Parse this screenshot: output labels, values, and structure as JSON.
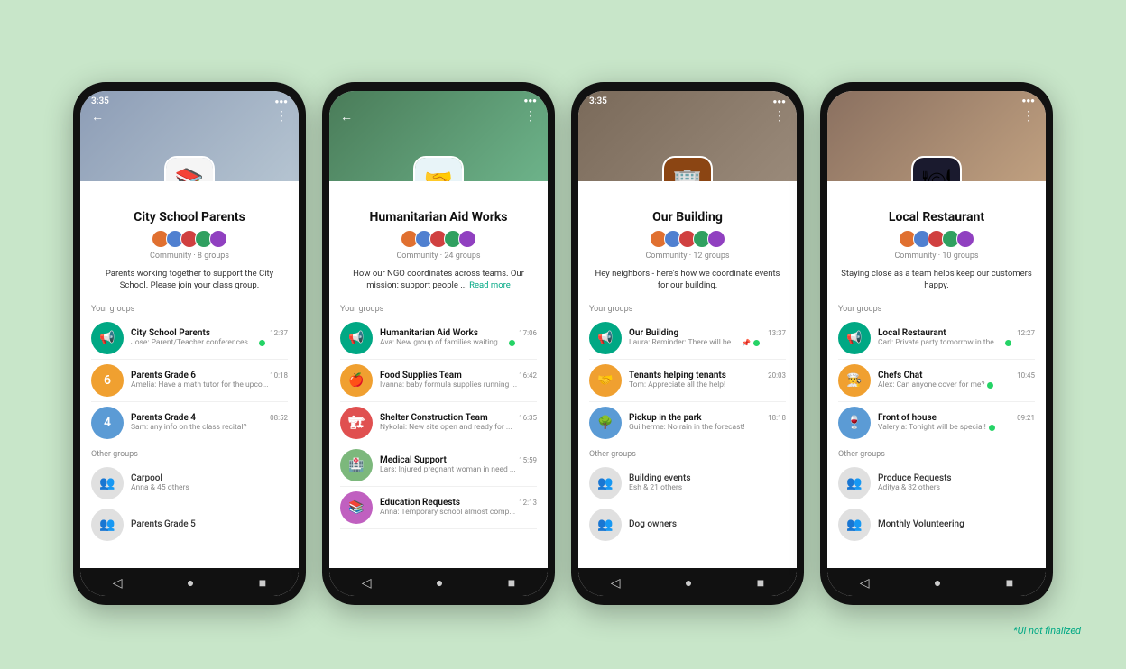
{
  "disclaimer": "*UI not finalized",
  "phones": [
    {
      "id": "city-school",
      "statusTime": "3:35",
      "headerClass": "hdr-school",
      "iconEmoji": "📚",
      "iconClass": "school-icon",
      "communityName": "City School Parents",
      "memberColors": [
        "#e07030",
        "#5080d0",
        "#d04040",
        "#30a060",
        "#9040c0"
      ],
      "meta": "Community · 8 groups",
      "description": "Parents working together to support the City School. Please join your class group.",
      "hasReadMore": false,
      "yourGroupsLabel": "Your groups",
      "yourGroups": [
        {
          "name": "City School Parents",
          "time": "12:37",
          "preview": "Jose: Parent/Teacher conferences ...",
          "hasDot": true,
          "avatarClass": "green-icon",
          "avatarIcon": "📢"
        },
        {
          "name": "Parents Grade 6",
          "time": "10:18",
          "preview": "Amelia: Have a math tutor for the upco...",
          "hasDot": false,
          "avatarClass": "color1",
          "avatarIcon": "6"
        },
        {
          "name": "Parents Grade 4",
          "time": "08:52",
          "preview": "Sam: any info on the class recital?",
          "hasDot": false,
          "avatarClass": "color2",
          "avatarIcon": "4"
        }
      ],
      "otherGroupsLabel": "Other groups",
      "otherGroups": [
        {
          "name": "Carpool",
          "sub": "Anna & 45 others"
        },
        {
          "name": "Parents Grade 5",
          "sub": ""
        }
      ]
    },
    {
      "id": "humanitarian",
      "statusTime": "",
      "headerClass": "hdr-aid",
      "iconEmoji": "🤝",
      "iconClass": "aid-icon",
      "communityName": "Humanitarian Aid Works",
      "memberColors": [
        "#e07030",
        "#5080d0",
        "#d04040",
        "#30a060",
        "#9040c0",
        "#40b0b0"
      ],
      "meta": "Community · 24 groups",
      "description": "How our NGO coordinates across teams. Our mission: support people ...",
      "hasReadMore": true,
      "readMoreText": "Read more",
      "yourGroupsLabel": "Your groups",
      "yourGroups": [
        {
          "name": "Humanitarian Aid Works",
          "time": "17:06",
          "preview": "Ava: New group of families waiting ...",
          "hasDot": true,
          "avatarClass": "green-icon",
          "avatarIcon": "📢"
        },
        {
          "name": "Food Supplies Team",
          "time": "16:42",
          "preview": "Ivanna: baby formula supplies running ...",
          "hasDot": false,
          "avatarClass": "color1",
          "avatarIcon": "🍎"
        },
        {
          "name": "Shelter Construction Team",
          "time": "16:35",
          "preview": "Nykolai: New site open and ready for ...",
          "hasDot": false,
          "avatarClass": "color3",
          "avatarIcon": "🏗"
        },
        {
          "name": "Medical Support",
          "time": "15:59",
          "preview": "Lars: Injured pregnant woman in need ...",
          "hasDot": false,
          "avatarClass": "color4",
          "avatarIcon": "🏥"
        },
        {
          "name": "Education Requests",
          "time": "12:13",
          "preview": "Anna: Temporary school almost comp...",
          "hasDot": false,
          "avatarClass": "color5",
          "avatarIcon": "📚"
        }
      ],
      "otherGroupsLabel": "",
      "otherGroups": []
    },
    {
      "id": "our-building",
      "statusTime": "3:35",
      "headerClass": "hdr-building",
      "iconEmoji": "🏢",
      "iconClass": "building-icon",
      "communityName": "Our Building",
      "memberColors": [
        "#e07030",
        "#5080d0",
        "#d04040",
        "#30a060",
        "#9040c0"
      ],
      "meta": "Community · 12 groups",
      "description": "Hey neighbors - here's how we coordinate events for our building.",
      "hasReadMore": false,
      "yourGroupsLabel": "Your groups",
      "yourGroups": [
        {
          "name": "Our Building",
          "time": "13:37",
          "preview": "Laura: Reminder: There will be ...",
          "hasDot": true,
          "hasPin": true,
          "avatarClass": "green-icon",
          "avatarIcon": "📢"
        },
        {
          "name": "Tenants helping tenants",
          "time": "20:03",
          "preview": "Tom: Appreciate all the help!",
          "hasDot": false,
          "avatarClass": "color1",
          "avatarIcon": "🤝"
        },
        {
          "name": "Pickup in the park",
          "time": "18:18",
          "preview": "Guilherme: No rain in the forecast!",
          "hasDot": false,
          "avatarClass": "color2",
          "avatarIcon": "🌳"
        }
      ],
      "otherGroupsLabel": "Other groups",
      "otherGroups": [
        {
          "name": "Building events",
          "sub": "Esh & 21 others"
        },
        {
          "name": "Dog owners",
          "sub": ""
        }
      ]
    },
    {
      "id": "local-restaurant",
      "statusTime": "",
      "headerClass": "hdr-restaurant",
      "iconEmoji": "🍽",
      "iconClass": "restaurant-icon",
      "communityName": "Local Restaurant",
      "memberColors": [
        "#e07030",
        "#5080d0",
        "#d04040",
        "#30a060",
        "#9040c0",
        "#40b0b0"
      ],
      "meta": "Community · 10 groups",
      "description": "Staying close as a team helps keep our customers happy.",
      "hasReadMore": false,
      "yourGroupsLabel": "Your groups",
      "yourGroups": [
        {
          "name": "Local Restaurant",
          "time": "12:27",
          "preview": "Carl: Private party tomorrow in the ...",
          "hasDot": true,
          "avatarClass": "green-icon",
          "avatarIcon": "📢"
        },
        {
          "name": "Chefs Chat",
          "time": "10:45",
          "preview": "Alex: Can anyone cover for me?",
          "hasDot": true,
          "avatarClass": "color1",
          "avatarIcon": "👨‍🍳"
        },
        {
          "name": "Front of house",
          "time": "09:21",
          "preview": "Valeryia: Tonight will be special!",
          "hasDot": true,
          "avatarClass": "color2",
          "avatarIcon": "🍷"
        }
      ],
      "otherGroupsLabel": "Other groups",
      "otherGroups": [
        {
          "name": "Produce Requests",
          "sub": "Aditya & 32 others"
        },
        {
          "name": "Monthly Volunteering",
          "sub": ""
        }
      ]
    }
  ]
}
